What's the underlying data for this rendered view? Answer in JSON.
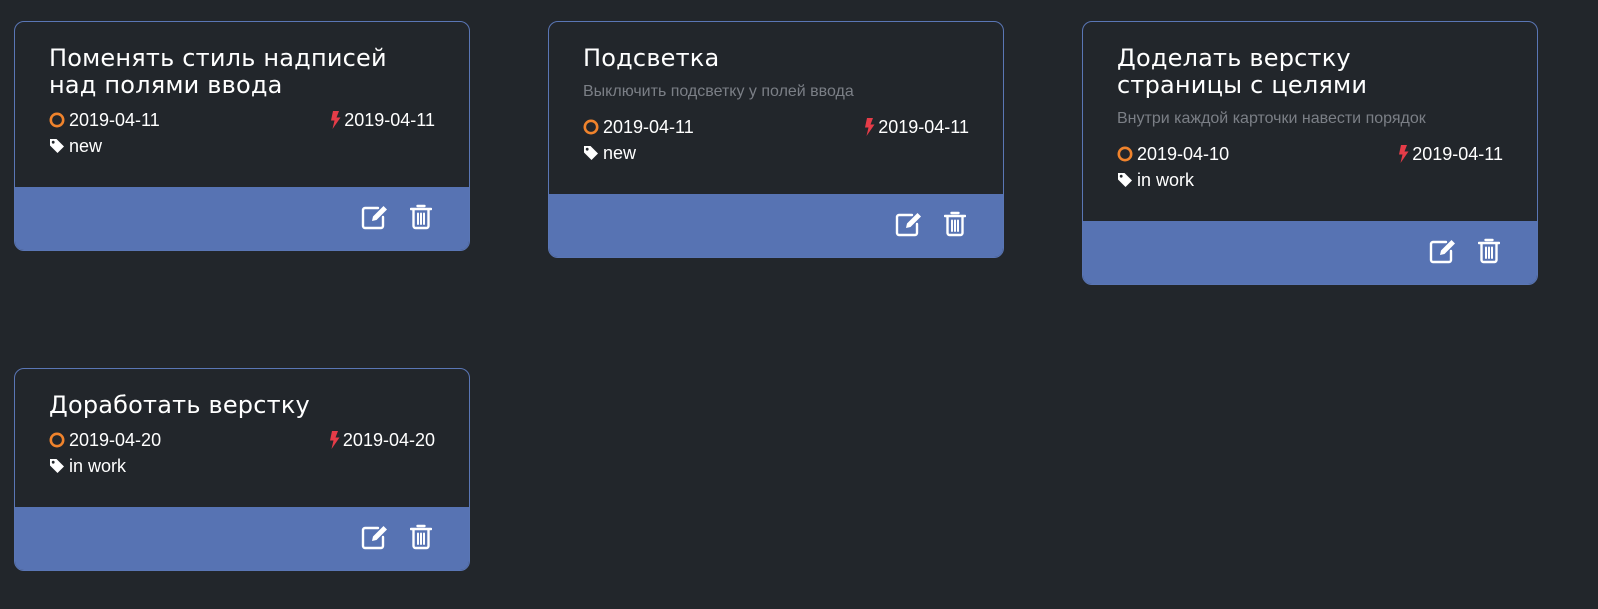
{
  "colors": {
    "background": "#22262b",
    "card_border": "#5a76b5",
    "footer": "#5773b3",
    "start_icon": "#f0832c",
    "deadline_icon": "#e53c48",
    "description": "#7b7f86"
  },
  "cards": [
    {
      "title": "Поменять стиль надписей над полями ввода",
      "description": "",
      "start_date": "2019-04-11",
      "deadline": "2019-04-11",
      "tag": "new",
      "icons": {
        "start": "circle-icon",
        "deadline": "bolt-icon",
        "tag": "tag-icon",
        "edit": "edit-icon",
        "delete": "trash-icon"
      }
    },
    {
      "title": "Подсветка",
      "description": "Выключить подсветку у полей ввода",
      "start_date": "2019-04-11",
      "deadline": "2019-04-11",
      "tag": "new",
      "icons": {
        "start": "circle-icon",
        "deadline": "bolt-icon",
        "tag": "tag-icon",
        "edit": "edit-icon",
        "delete": "trash-icon"
      }
    },
    {
      "title": "Доделать верстку страницы с целями",
      "description": "Внутри каждой карточки навести порядок",
      "start_date": "2019-04-10",
      "deadline": "2019-04-11",
      "tag": "in work",
      "icons": {
        "start": "circle-icon",
        "deadline": "bolt-icon",
        "tag": "tag-icon",
        "edit": "edit-icon",
        "delete": "trash-icon"
      }
    },
    {
      "title": "Доработать верстку",
      "description": "",
      "start_date": "2019-04-20",
      "deadline": "2019-04-20",
      "tag": "in work",
      "icons": {
        "start": "circle-icon",
        "deadline": "bolt-icon",
        "tag": "tag-icon",
        "edit": "edit-icon",
        "delete": "trash-icon"
      }
    }
  ]
}
